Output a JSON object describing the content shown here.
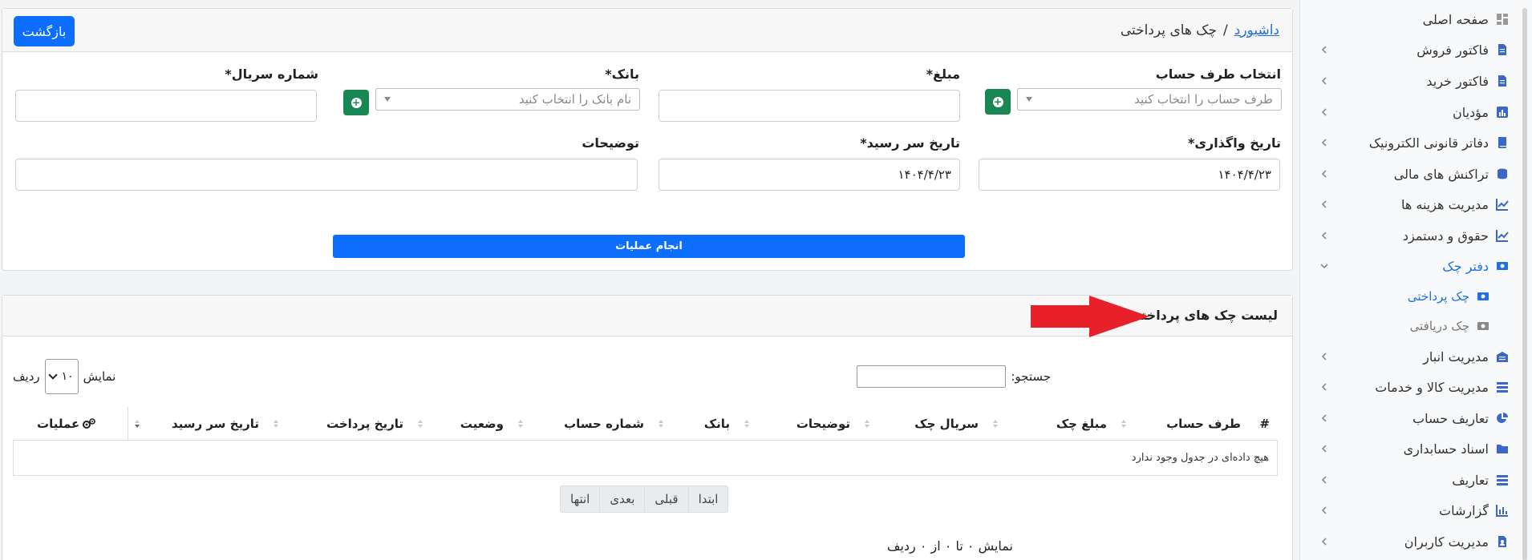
{
  "breadcrumb": {
    "home": "داشبورد",
    "separator": "/",
    "current": "چک های پرداختی"
  },
  "header": {
    "back_button": "بازگشت"
  },
  "form": {
    "party_label": "انتخاب طرف حساب",
    "party_placeholder": "طرف حساب را انتخاب کنید",
    "amount_label": "مبلغ*",
    "amount_value": "",
    "bank_label": "بانک*",
    "bank_placeholder": "نام بانک را انتخاب کنید",
    "serial_label": "شماره سریال*",
    "serial_value": "",
    "assign_date_label": "تاریخ واگذاری*",
    "assign_date_value": "۱۴۰۴/۴/۲۳",
    "due_date_label": "تاریخ سر رسید*",
    "due_date_value": "۱۴۰۴/۴/۲۳",
    "description_label": "توضیحات",
    "description_value": "",
    "submit_button": "انجام عملیات"
  },
  "list": {
    "title": "لیست چک های پرداختی",
    "search_label": "جستجو:",
    "search_value": "",
    "show_label": "نمایش",
    "rows_label": "ردیف",
    "page_length": "۱۰",
    "columns": [
      "#",
      "طرف حساب",
      "مبلغ چک",
      "سریال چک",
      "توضیحات",
      "بانک",
      "شماره حساب",
      "وضعیت",
      "تاریخ پرداخت",
      "تاریخ سر رسید",
      "عملیات"
    ],
    "empty_message": "هیچ داده‌ای در جدول وجود ندارد",
    "pagination": [
      "ابتدا",
      "قبلی",
      "بعدی",
      "انتها"
    ],
    "info": "نمایش ۰ تا ۰ از ۰ ردیف"
  },
  "sidebar": {
    "items": [
      {
        "label": "صفحه اصلی",
        "icon": "dashboard-icon",
        "has_children": false
      },
      {
        "label": "فاکتور فروش",
        "icon": "file-icon",
        "has_children": true
      },
      {
        "label": "فاکتور خرید",
        "icon": "file-icon",
        "has_children": true
      },
      {
        "label": "مؤدیان",
        "icon": "chart-icon",
        "has_children": true
      },
      {
        "label": "دفاتر قانونی الکترونیک",
        "icon": "book-icon",
        "has_children": true
      },
      {
        "label": "تراکنش های مالی",
        "icon": "coins-icon",
        "has_children": true
      },
      {
        "label": "مدیریت هزینه ها",
        "icon": "line-chart-icon",
        "has_children": true
      },
      {
        "label": "حقوق و دستمزد",
        "icon": "line-chart-icon",
        "has_children": true
      },
      {
        "label": "دفتر چک",
        "icon": "money-icon",
        "has_children": true,
        "active": true
      },
      {
        "label": "چک پرداختی",
        "icon": "money-icon",
        "sub": true,
        "active": true
      },
      {
        "label": "چک دریافتی",
        "icon": "money-icon",
        "sub": true
      },
      {
        "label": "مدیریت انبار",
        "icon": "warehouse-icon",
        "has_children": true
      },
      {
        "label": "مدیریت کالا و خدمات",
        "icon": "list-icon",
        "has_children": true
      },
      {
        "label": "تعاریف حساب",
        "icon": "pie-chart-icon",
        "has_children": true
      },
      {
        "label": "اسناد حسابداری",
        "icon": "folder-icon",
        "has_children": true
      },
      {
        "label": "تعاریف",
        "icon": "list-icon",
        "has_children": true
      },
      {
        "label": "گزارشات",
        "icon": "bar-chart-icon",
        "has_children": true
      },
      {
        "label": "مدیریت کاربران",
        "icon": "user-file-icon",
        "has_children": true
      }
    ]
  },
  "colors": {
    "primary": "#0d6efd",
    "success": "#198754",
    "accent": "#1f6fe5",
    "annotation_arrow": "#e8202a"
  }
}
